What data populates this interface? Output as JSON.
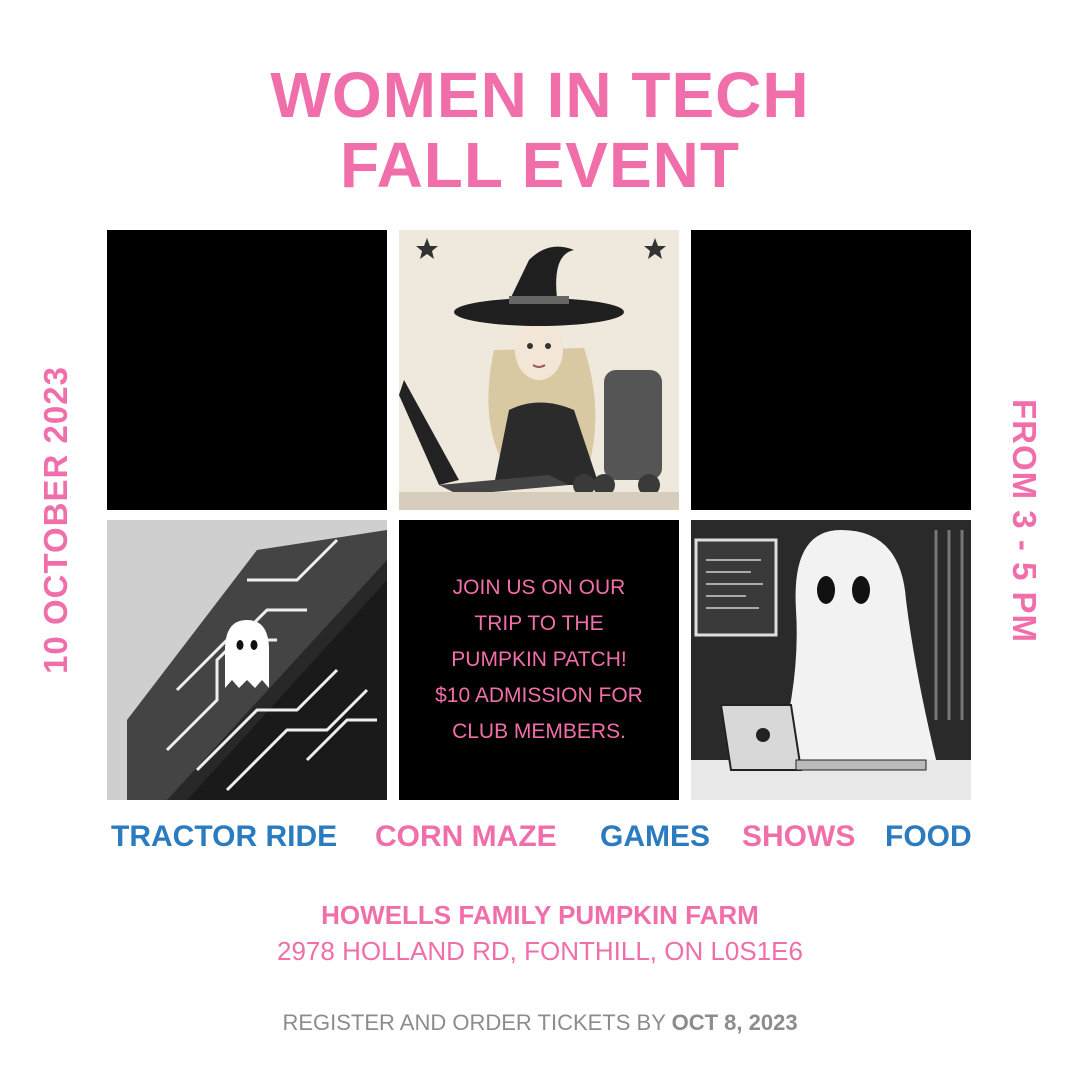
{
  "title": {
    "line1": "WOMEN IN TECH",
    "line2": "FALL EVENT"
  },
  "date": "10 OCTOBER 2023",
  "time": "FROM 3 - 5 PM",
  "invite": {
    "line1": "JOIN US ON OUR",
    "line2": "TRIP TO THE",
    "line3": "PUMPKIN PATCH!",
    "line4": "$10 ADMISSION FOR",
    "line5": "CLUB MEMBERS."
  },
  "activities": [
    {
      "label": "TRACTOR RIDE",
      "color": "#2b7bbf"
    },
    {
      "label": "CORN MAZE",
      "color": "#f06eaa"
    },
    {
      "label": "GAMES",
      "color": "#2b7bbf"
    },
    {
      "label": "SHOWS",
      "color": "#f06eaa"
    },
    {
      "label": "FOOD",
      "color": "#2b7bbf"
    }
  ],
  "venue": {
    "name": "HOWELLS FAMILY PUMPKIN FARM",
    "address": "2978 HOLLAND RD, FONTHILL, ON L0S1E6"
  },
  "register": {
    "prefix": "REGISTER AND ORDER TICKETS BY ",
    "deadline": "OCT 8, 2023"
  },
  "colors": {
    "pink": "#f06eaa",
    "blue": "#2b7bbf",
    "gray": "#8c8c8c",
    "tile_black": "#000000"
  },
  "images": {
    "tile_2": "witch-at-laptop-illustration",
    "tile_4": "ghost-on-circuit-board-illustration",
    "tile_6": "ghost-at-laptop-illustration"
  }
}
